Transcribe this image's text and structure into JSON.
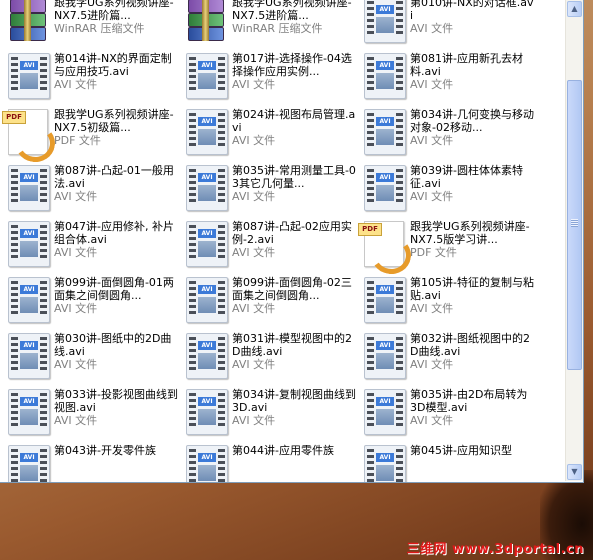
{
  "files": [
    {
      "name": "跟我学UG系列视频讲座-NX7.5进阶篇...",
      "type": "WinRAR 压缩文件",
      "icon": "rar-icon"
    },
    {
      "name": "跟我学UG系列视频讲座-NX7.5进阶篇...",
      "type": "WinRAR 压缩文件",
      "icon": "rar-icon"
    },
    {
      "name": "第010讲-NX的对话框.avi",
      "type": "AVI 文件",
      "icon": "avi-icon"
    },
    {
      "name": "第014讲-NX的界面定制与应用技巧.avi",
      "type": "AVI 文件",
      "icon": "avi-icon"
    },
    {
      "name": "第017讲-选择操作-04选择操作应用实例...",
      "type": "AVI 文件",
      "icon": "avi-icon"
    },
    {
      "name": "第081讲-应用新孔去材料.avi",
      "type": "AVI 文件",
      "icon": "avi-icon"
    },
    {
      "name": "跟我学UG系列视频讲座-NX7.5初级篇...",
      "type": "PDF 文件",
      "icon": "pdf-icon"
    },
    {
      "name": "第024讲-视图布局管理.avi",
      "type": "AVI 文件",
      "icon": "avi-icon"
    },
    {
      "name": "第034讲-几何变换与移动对象-02移动...",
      "type": "AVI 文件",
      "icon": "avi-icon"
    },
    {
      "name": "第087讲-凸起-01一般用法.avi",
      "type": "AVI 文件",
      "icon": "avi-icon"
    },
    {
      "name": "第035讲-常用测量工具-03其它几何量...",
      "type": "AVI 文件",
      "icon": "avi-icon"
    },
    {
      "name": "第039讲-圆柱体体素特征.avi",
      "type": "AVI 文件",
      "icon": "avi-icon"
    },
    {
      "name": "第047讲-应用修补, 补片组合体.avi",
      "type": "AVI 文件",
      "icon": "avi-icon"
    },
    {
      "name": "第087讲-凸起-02应用实例-2.avi",
      "type": "AVI 文件",
      "icon": "avi-icon"
    },
    {
      "name": "跟我学UG系列视频讲座-NX7.5版学习讲...",
      "type": "PDF 文件",
      "icon": "pdf-icon"
    },
    {
      "name": "第099讲-面倒圆角-01两面集之间倒圆角...",
      "type": "AVI 文件",
      "icon": "avi-icon"
    },
    {
      "name": "第099讲-面倒圆角-02三面集之间倒圆角...",
      "type": "AVI 文件",
      "icon": "avi-icon"
    },
    {
      "name": "第105讲-特征的复制与粘贴.avi",
      "type": "AVI 文件",
      "icon": "avi-icon"
    },
    {
      "name": "第030讲-图纸中的2D曲线.avi",
      "type": "AVI 文件",
      "icon": "avi-icon"
    },
    {
      "name": "第031讲-模型视图中的2D曲线.avi",
      "type": "AVI 文件",
      "icon": "avi-icon"
    },
    {
      "name": "第032讲-图纸视图中的2D曲线.avi",
      "type": "AVI 文件",
      "icon": "avi-icon"
    },
    {
      "name": "第033讲-投影视图曲线到视图.avi",
      "type": "AVI 文件",
      "icon": "avi-icon"
    },
    {
      "name": "第034讲-复制视图曲线到3D.avi",
      "type": "AVI 文件",
      "icon": "avi-icon"
    },
    {
      "name": "第035讲-由2D布局转为3D模型.avi",
      "type": "AVI 文件",
      "icon": "avi-icon"
    },
    {
      "name": "第043讲-开发零件族",
      "type": "",
      "icon": "avi-icon"
    },
    {
      "name": "第044讲-应用零件族",
      "type": "",
      "icon": "avi-icon"
    },
    {
      "name": "第045讲-应用知识型",
      "type": "",
      "icon": "avi-icon"
    }
  ],
  "scrollbar": {
    "up_glyph": "▲",
    "down_glyph": "▼",
    "position": 0.45
  },
  "watermark": "三维网 www.3dportal.cn",
  "colors": {
    "selection_bg": "#ffffff",
    "type_text": "#808080",
    "watermark": "#e01818"
  }
}
